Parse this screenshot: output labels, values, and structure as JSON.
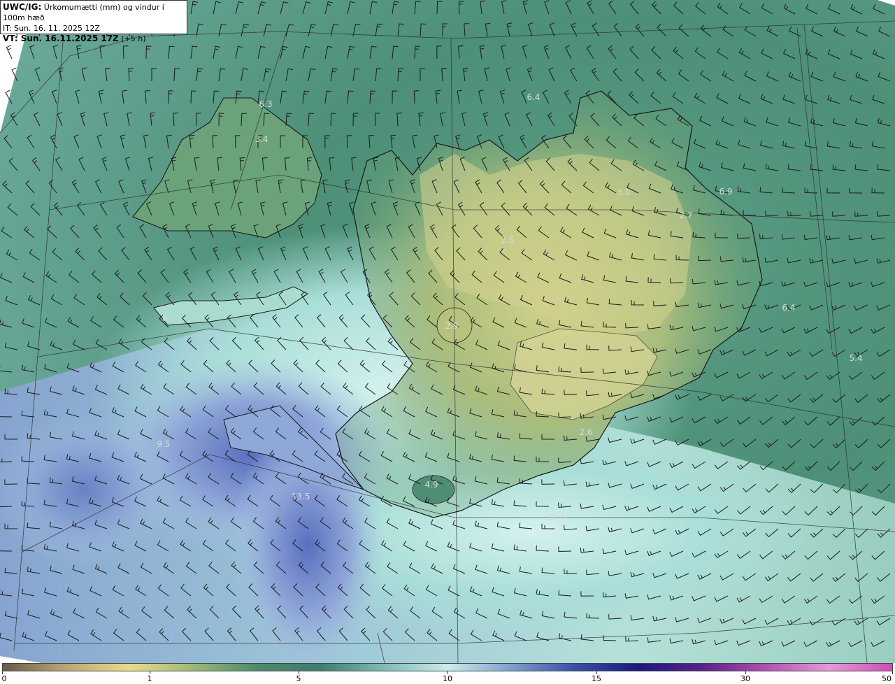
{
  "title": {
    "model": "UWC/IG:",
    "field": "Úrkomumætti (mm) og vindur í 100m hæð",
    "init_time": "IT: Sun. 16. 11. 2025 12Z",
    "valid_prefix": "VT: Sun. 16.11.2025 17Z",
    "valid_suffix": "(+5 h)"
  },
  "value_labels": [
    "6.3",
    "3.4",
    "6.4",
    "3.0",
    "6.9",
    "2.7",
    "2.6",
    "6.4",
    "2.9",
    "6",
    "5.4",
    "9.5",
    "2.6",
    "4.9",
    "13.5",
    "10.6"
  ],
  "colorbar": {
    "ticks": [
      "0",
      "1",
      "5",
      "10",
      "15",
      "30",
      "50"
    ],
    "colors": [
      "#6b5a45",
      "#b9a676",
      "#e8dc8a",
      "#9cb877",
      "#4c8a6a",
      "#3f7d6f",
      "#7fbcb3",
      "#c9ecea",
      "#7f9fd0",
      "#3a4ea8",
      "#1a1a80",
      "#5b1f8a",
      "#b04fb0",
      "#e79ad6",
      "#d04cb8"
    ]
  }
}
